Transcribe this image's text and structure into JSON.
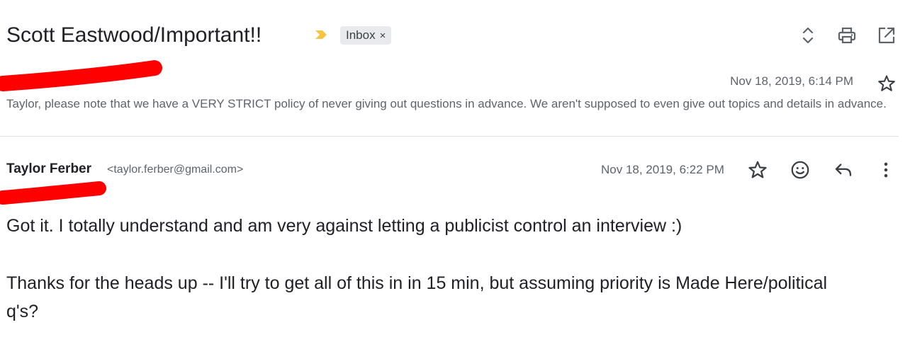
{
  "thread": {
    "subject": "Scott Eastwood/Important!!",
    "label": "Inbox",
    "label_close": "×"
  },
  "messages": [
    {
      "sender_name": "",
      "date": "Nov 18, 2019, 6:14 PM",
      "snippet": "Taylor, please note that we have a VERY STRICT policy of never giving out questions in advance. We aren't supposed to even give out topics and details in advance."
    },
    {
      "sender_name": "Taylor Ferber",
      "sender_email": "<taylor.ferber@gmail.com>",
      "date": "Nov 18, 2019, 6:22 PM",
      "body": [
        "Got it. I totally understand and am very against letting a publicist control an interview :)",
        "Thanks for the heads up -- I'll try to get all of this in in 15 min, but assuming priority is Made Here/political q's?"
      ]
    }
  ],
  "icons": {
    "importance_marker": "importance-marker-icon",
    "expand": "expand-collapse-icon",
    "print": "print-icon",
    "open_new_window": "open-in-new-window-icon",
    "star": "star-icon",
    "emoji": "emoji-reaction-icon",
    "reply": "reply-icon",
    "more": "more-options-icon"
  },
  "colors": {
    "importance": "#f4c542",
    "redaction": "#ff0000",
    "chip_background": "#e8eaed",
    "muted_text": "#5f6368"
  }
}
